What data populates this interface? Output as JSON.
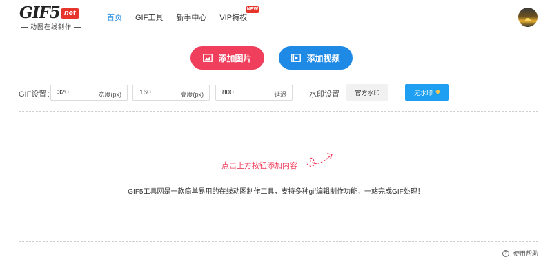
{
  "logo": {
    "main": "GIF5.",
    "net": "net",
    "subtitle": "动图在线制作"
  },
  "nav": {
    "items": [
      "首页",
      "GIF工具",
      "新手中心",
      "VIP特权"
    ],
    "new_badge": "NEW"
  },
  "actions": {
    "add_image": "添加图片",
    "add_video": "添加视频"
  },
  "settings": {
    "gif_label": "GIF设置：",
    "width_value": "320",
    "width_unit": "宽度(px)",
    "height_value": "160",
    "height_unit": "高度(px)",
    "delay_value": "800",
    "delay_unit": "延迟",
    "watermark_label": "水印设置",
    "official_watermark": "官方水印",
    "no_watermark": "无水印"
  },
  "dropzone": {
    "hint": "点击上方按钮添加内容",
    "description": "GIF5工具网是一款简单易用的在线动图制作工具，支持多种gif编辑制作功能，一站完成GIF处理！"
  },
  "help": {
    "label": "使用帮助",
    "icon": "?"
  },
  "colors": {
    "accent_red": "#ef3f5d",
    "accent_blue": "#1e8ae6",
    "nav_active": "#2b8fe3"
  }
}
